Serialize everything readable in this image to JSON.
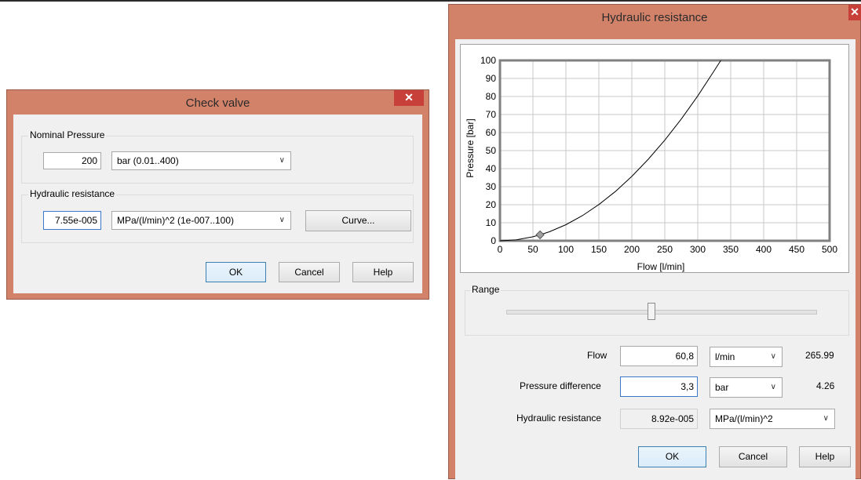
{
  "check_valve": {
    "title": "Check valve",
    "close_glyph": "✕",
    "nominal_pressure": {
      "group_label": "Nominal Pressure",
      "value": "200",
      "unit": "bar  (0.01..400)"
    },
    "hydraulic_resistance": {
      "group_label": "Hydraulic resistance",
      "value": "7.55e-005",
      "unit": "MPa/(l/min)^2  (1e-007..100)",
      "curve_button": "Curve..."
    },
    "buttons": {
      "ok": "OK",
      "cancel": "Cancel",
      "help": "Help"
    }
  },
  "hydraulic_window": {
    "title": "Hydraulic resistance",
    "close_glyph": "✕",
    "range_label": "Range",
    "range_slider_fraction": 0.47,
    "flow": {
      "label": "Flow",
      "value": "60,8",
      "unit": "l/min",
      "readout": "265.99"
    },
    "pressure_difference": {
      "label": "Pressure difference",
      "value": "3,3",
      "unit": "bar",
      "readout": "4.26"
    },
    "hydraulic_resistance": {
      "label": "Hydraulic resistance",
      "value": "8.92e-005",
      "unit": "MPa/(l/min)^2"
    },
    "buttons": {
      "ok": "OK",
      "cancel": "Cancel",
      "help": "Help"
    }
  },
  "chart_data": {
    "type": "line",
    "title": "",
    "xlabel": "Flow [l/min]",
    "ylabel": "Pressure [bar]",
    "xlim": [
      0,
      500
    ],
    "ylim": [
      0,
      100
    ],
    "x_ticks": [
      0,
      50,
      100,
      150,
      200,
      250,
      300,
      350,
      400,
      450,
      500
    ],
    "y_ticks": [
      0,
      10,
      20,
      30,
      40,
      50,
      60,
      70,
      80,
      90,
      100
    ],
    "grid": true,
    "series": [
      {
        "x": [
          0,
          25,
          50,
          60.8,
          75,
          100,
          125,
          150,
          175,
          200,
          225,
          250,
          275,
          300,
          325,
          335
        ],
        "y": [
          0,
          0.56,
          2.2,
          3.3,
          5.0,
          8.9,
          13.9,
          20.1,
          27.3,
          35.7,
          45.2,
          55.8,
          67.5,
          80.3,
          94.3,
          100
        ]
      }
    ],
    "marker": {
      "x": 60.8,
      "y": 3.3,
      "shape": "diamond"
    },
    "colors": {
      "line": "#000000",
      "grid": "#c8c8c8",
      "marker": "#a0a0a0"
    }
  }
}
